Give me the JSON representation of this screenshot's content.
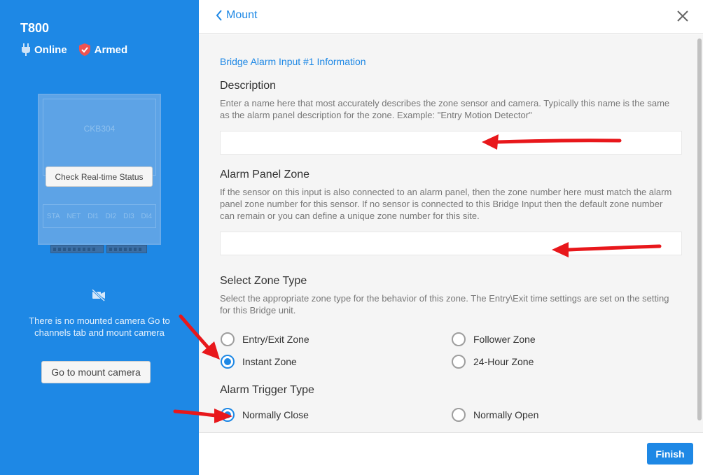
{
  "sidebar": {
    "device_name": "T800",
    "status_online": "Online",
    "status_armed": "Armed",
    "device_model": "CKB304",
    "device_leds": [
      "STA",
      "NET",
      "DI1",
      "DI2",
      "DI3",
      "DI4"
    ],
    "check_status_label": "Check Real-time Status",
    "no_camera_message": "There is no mounted camera Go to channels tab and mount camera",
    "mount_camera_label": "Go to mount camera"
  },
  "header": {
    "back_label": "Mount"
  },
  "form": {
    "section_title": "Bridge Alarm Input #1 Information",
    "description": {
      "label": "Description",
      "hint": "Enter a name here that most accurately describes the zone sensor and camera. Typically this name is the same as the alarm panel description for the zone. Example: \"Entry Motion Detector\"",
      "value": ""
    },
    "alarm_panel_zone": {
      "label": "Alarm Panel Zone",
      "hint": "If the sensor on this input is also connected to an alarm panel, then the zone number here must match the alarm panel zone number for this sensor. If no sensor is connected to this Bridge Input then the default zone number can remain or you can define a unique zone number for this site.",
      "value": ""
    },
    "zone_type": {
      "label": "Select Zone Type",
      "hint": "Select the appropriate zone type for the behavior of this zone. The Entry\\Exit time settings are set on the setting for this Bridge unit.",
      "options": [
        "Entry/Exit Zone",
        "Follower Zone",
        "Instant Zone",
        "24-Hour Zone"
      ],
      "selected": "Instant Zone"
    },
    "trigger_type": {
      "label": "Alarm Trigger Type",
      "options": [
        "Normally Close",
        "Normally Open"
      ],
      "selected": "Normally Close"
    }
  },
  "footer": {
    "finish_label": "Finish"
  },
  "colors": {
    "accent": "#1e88e5",
    "annotation_arrow": "#e8171b"
  }
}
